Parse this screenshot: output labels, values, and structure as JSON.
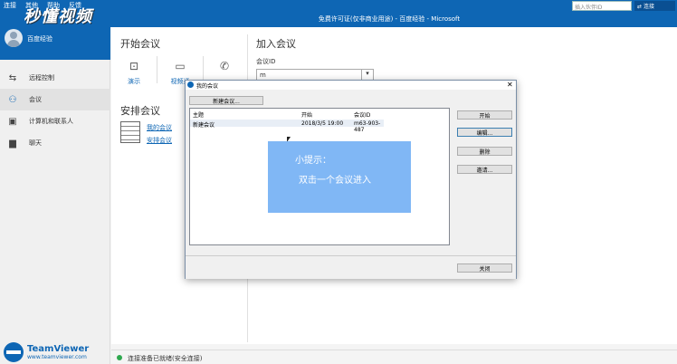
{
  "menu": [
    "连接",
    "其他",
    "帮助",
    "反馈"
  ],
  "title_text": "免费许可证(仅非商业用途) - 百度经验 - Microsoft",
  "watermark": "秒懂视频",
  "partner_placeholder": "插入伙伴ID",
  "connect_label": "连接",
  "profile": {
    "name": "百度经验"
  },
  "nav": [
    {
      "label": "远程控制",
      "icon": "arrows-icon"
    },
    {
      "label": "会议",
      "icon": "meeting-icon",
      "active": true
    },
    {
      "label": "计算机和联系人",
      "icon": "contacts-icon"
    },
    {
      "label": "聊天",
      "icon": "chat-icon"
    }
  ],
  "brand": {
    "name": "TeamViewer",
    "url": "www.teamviewer.com"
  },
  "start_meeting": {
    "title": "开始会议",
    "tiles": [
      {
        "label": "演示",
        "icon": "presentation-icon"
      },
      {
        "label": "视频通",
        "icon": "video-icon"
      },
      {
        "label": "",
        "icon": "phone-icon"
      }
    ]
  },
  "schedule": {
    "title": "安排会议",
    "links": [
      "我的会议",
      "安排会议"
    ]
  },
  "join": {
    "title": "加入会议",
    "id_label": "会议ID",
    "id_value": "m"
  },
  "status": "连接准备已就绪(安全连接)",
  "dialog": {
    "title": "我的会议",
    "new_button": "新建会议...",
    "columns": [
      "主题",
      "开始",
      "会议ID"
    ],
    "rows": [
      {
        "subject": "新建会议",
        "start": "2018/3/5 19:00",
        "id": "m63-903-487"
      }
    ],
    "side_buttons": [
      "开始",
      "编辑...",
      "删除",
      "邀请..."
    ],
    "close_button": "关闭"
  },
  "tip": {
    "title": "小提示：",
    "text": "双击一个会议进入"
  }
}
